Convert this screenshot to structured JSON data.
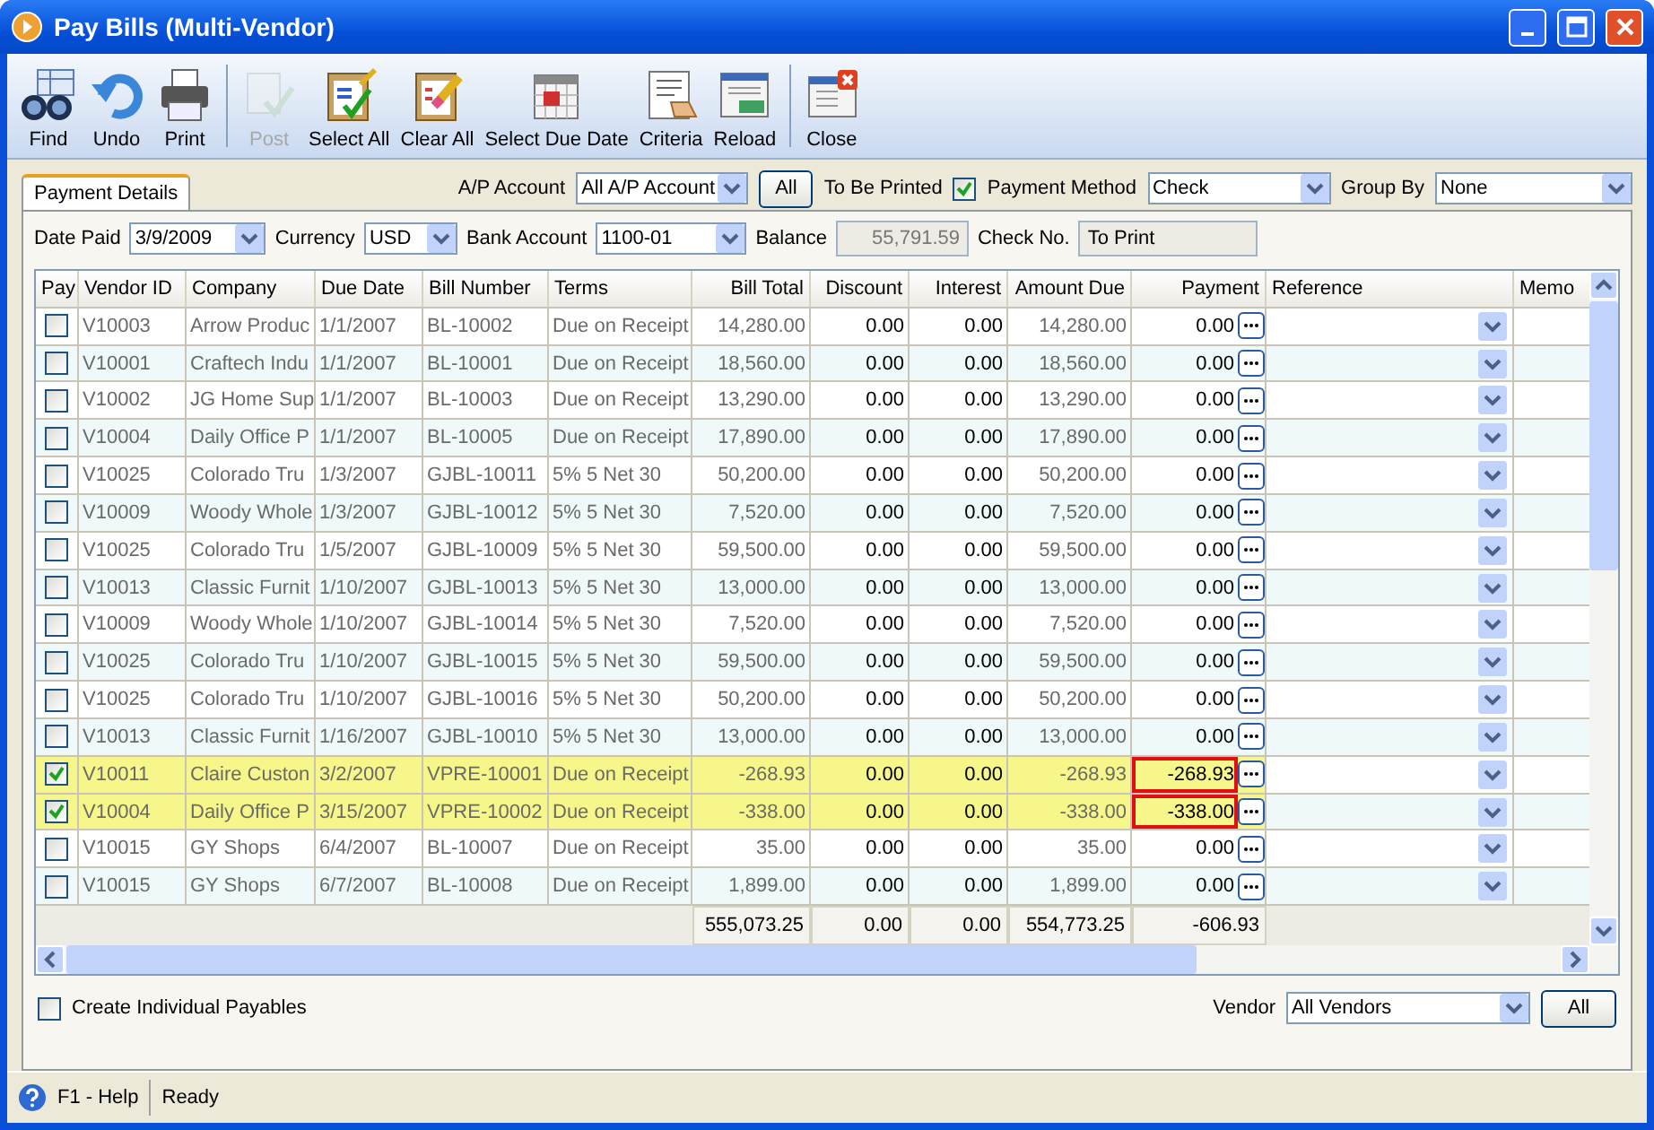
{
  "window": {
    "title": "Pay Bills (Multi-Vendor)"
  },
  "toolbar": [
    [
      {
        "label": "Find",
        "disabled": false
      },
      {
        "label": "Undo",
        "disabled": false
      },
      {
        "label": "Print",
        "disabled": false
      }
    ],
    [
      {
        "label": "Post",
        "disabled": true
      },
      {
        "label": "Select All",
        "disabled": false
      },
      {
        "label": "Clear All",
        "disabled": false
      },
      {
        "label": "Select Due Date",
        "disabled": false
      },
      {
        "label": "Criteria",
        "disabled": false
      },
      {
        "label": "Reload",
        "disabled": false
      }
    ],
    [
      {
        "label": "Close",
        "disabled": false
      }
    ]
  ],
  "tabs": [
    {
      "label": "Payment Details",
      "selected": true
    }
  ],
  "filters": {
    "ap_account_label": "A/P Account",
    "ap_account": "All A/P Account",
    "all_button": "All",
    "to_be_printed_label": "To Be Printed",
    "to_be_printed": true,
    "payment_method_label": "Payment Method",
    "payment_method": "Check",
    "group_by_label": "Group By",
    "group_by": "None"
  },
  "details": {
    "date_paid_label": "Date Paid",
    "date_paid": "3/9/2009",
    "currency_label": "Currency",
    "currency": "USD",
    "bank_account_label": "Bank Account",
    "bank_account": "1100-01",
    "balance_label": "Balance",
    "balance": "55,791.59",
    "check_no_label": "Check No.",
    "check_no": "To Print"
  },
  "table": {
    "columns": [
      "Pay",
      "Vendor ID",
      "Company",
      "Due Date",
      "Bill Number",
      "Terms",
      "Bill Total",
      "Discount",
      "Interest",
      "Amount Due",
      "Payment",
      "Reference",
      "Memo"
    ],
    "rows": [
      {
        "pay": false,
        "selected": false,
        "vendor_id": "V10003",
        "company": "Arrow Produc",
        "due_date": "1/1/2007",
        "bill_number": "BL-10002",
        "terms": "Due on Receipt",
        "bill_total": "14,280.00",
        "discount": "0.00",
        "interest": "0.00",
        "amount_due": "14,280.00",
        "payment": "0.00"
      },
      {
        "pay": false,
        "selected": false,
        "vendor_id": "V10001",
        "company": "Craftech Indu",
        "due_date": "1/1/2007",
        "bill_number": "BL-10001",
        "terms": "Due on Receipt",
        "bill_total": "18,560.00",
        "discount": "0.00",
        "interest": "0.00",
        "amount_due": "18,560.00",
        "payment": "0.00"
      },
      {
        "pay": false,
        "selected": false,
        "vendor_id": "V10002",
        "company": "JG Home Sup",
        "due_date": "1/1/2007",
        "bill_number": "BL-10003",
        "terms": "Due on Receipt",
        "bill_total": "13,290.00",
        "discount": "0.00",
        "interest": "0.00",
        "amount_due": "13,290.00",
        "payment": "0.00"
      },
      {
        "pay": false,
        "selected": false,
        "vendor_id": "V10004",
        "company": "Daily Office P",
        "due_date": "1/1/2007",
        "bill_number": "BL-10005",
        "terms": "Due on Receipt",
        "bill_total": "17,890.00",
        "discount": "0.00",
        "interest": "0.00",
        "amount_due": "17,890.00",
        "payment": "0.00"
      },
      {
        "pay": false,
        "selected": false,
        "vendor_id": "V10025",
        "company": "Colorado Tru",
        "due_date": "1/3/2007",
        "bill_number": "GJBL-10011",
        "terms": "5% 5 Net 30",
        "bill_total": "50,200.00",
        "discount": "0.00",
        "interest": "0.00",
        "amount_due": "50,200.00",
        "payment": "0.00"
      },
      {
        "pay": false,
        "selected": false,
        "vendor_id": "V10009",
        "company": "Woody Whole",
        "due_date": "1/3/2007",
        "bill_number": "GJBL-10012",
        "terms": "5% 5 Net 30",
        "bill_total": "7,520.00",
        "discount": "0.00",
        "interest": "0.00",
        "amount_due": "7,520.00",
        "payment": "0.00"
      },
      {
        "pay": false,
        "selected": false,
        "vendor_id": "V10025",
        "company": "Colorado Tru",
        "due_date": "1/5/2007",
        "bill_number": "GJBL-10009",
        "terms": "5% 5 Net 30",
        "bill_total": "59,500.00",
        "discount": "0.00",
        "interest": "0.00",
        "amount_due": "59,500.00",
        "payment": "0.00"
      },
      {
        "pay": false,
        "selected": false,
        "vendor_id": "V10013",
        "company": "Classic Furnit",
        "due_date": "1/10/2007",
        "bill_number": "GJBL-10013",
        "terms": "5% 5 Net 30",
        "bill_total": "13,000.00",
        "discount": "0.00",
        "interest": "0.00",
        "amount_due": "13,000.00",
        "payment": "0.00"
      },
      {
        "pay": false,
        "selected": false,
        "vendor_id": "V10009",
        "company": "Woody Whole",
        "due_date": "1/10/2007",
        "bill_number": "GJBL-10014",
        "terms": "5% 5 Net 30",
        "bill_total": "7,520.00",
        "discount": "0.00",
        "interest": "0.00",
        "amount_due": "7,520.00",
        "payment": "0.00"
      },
      {
        "pay": false,
        "selected": false,
        "vendor_id": "V10025",
        "company": "Colorado Tru",
        "due_date": "1/10/2007",
        "bill_number": "GJBL-10015",
        "terms": "5% 5 Net 30",
        "bill_total": "59,500.00",
        "discount": "0.00",
        "interest": "0.00",
        "amount_due": "59,500.00",
        "payment": "0.00"
      },
      {
        "pay": false,
        "selected": false,
        "vendor_id": "V10025",
        "company": "Colorado Tru",
        "due_date": "1/10/2007",
        "bill_number": "GJBL-10016",
        "terms": "5% 5 Net 30",
        "bill_total": "50,200.00",
        "discount": "0.00",
        "interest": "0.00",
        "amount_due": "50,200.00",
        "payment": "0.00"
      },
      {
        "pay": false,
        "selected": false,
        "vendor_id": "V10013",
        "company": "Classic Furnit",
        "due_date": "1/16/2007",
        "bill_number": "GJBL-10010",
        "terms": "5% 5 Net 30",
        "bill_total": "13,000.00",
        "discount": "0.00",
        "interest": "0.00",
        "amount_due": "13,000.00",
        "payment": "0.00"
      },
      {
        "pay": true,
        "selected": true,
        "vendor_id": "V10011",
        "company": "Claire Custon",
        "due_date": "3/2/2007",
        "bill_number": "VPRE-10001",
        "terms": "Due on Receipt",
        "bill_total": "-268.93",
        "discount": "0.00",
        "interest": "0.00",
        "amount_due": "-268.93",
        "payment": "-268.93"
      },
      {
        "pay": true,
        "selected": true,
        "vendor_id": "V10004",
        "company": "Daily Office P",
        "due_date": "3/15/2007",
        "bill_number": "VPRE-10002",
        "terms": "Due on Receipt",
        "bill_total": "-338.00",
        "discount": "0.00",
        "interest": "0.00",
        "amount_due": "-338.00",
        "payment": "-338.00"
      },
      {
        "pay": false,
        "selected": false,
        "vendor_id": "V10015",
        "company": "GY Shops",
        "due_date": "6/4/2007",
        "bill_number": "BL-10007",
        "terms": "Due on Receipt",
        "bill_total": "35.00",
        "discount": "0.00",
        "interest": "0.00",
        "amount_due": "35.00",
        "payment": "0.00"
      },
      {
        "pay": false,
        "selected": false,
        "vendor_id": "V10015",
        "company": "GY Shops",
        "due_date": "6/7/2007",
        "bill_number": "BL-10008",
        "terms": "Due on Receipt",
        "bill_total": "1,899.00",
        "discount": "0.00",
        "interest": "0.00",
        "amount_due": "1,899.00",
        "payment": "0.00"
      }
    ],
    "totals": {
      "bill_total": "555,073.25",
      "discount": "0.00",
      "interest": "0.00",
      "amount_due": "554,773.25",
      "payment": "-606.93"
    }
  },
  "bottom": {
    "create_individual_label": "Create Individual Payables",
    "create_individual": false,
    "vendor_label": "Vendor",
    "vendor": "All Vendors",
    "all_button": "All"
  },
  "status_bar": {
    "help": "F1 - Help",
    "status": "Ready"
  }
}
